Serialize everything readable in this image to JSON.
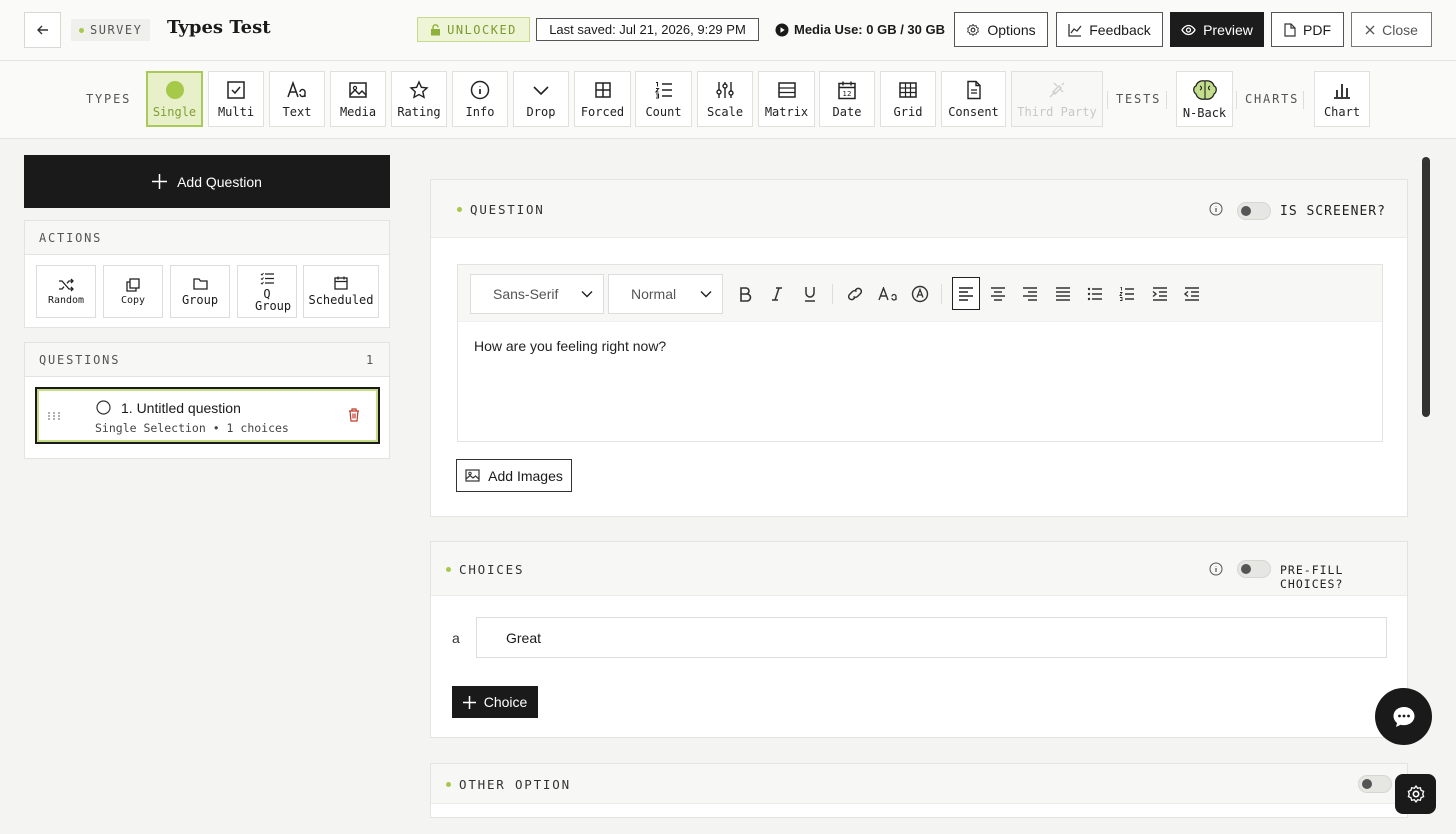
{
  "header": {
    "survey_tag": "SURVEY",
    "title": "Types Test",
    "lock_status": "UNLOCKED",
    "last_saved": "Last saved: Jul 21, 2026, 9:29 PM",
    "media_use": "Media Use: 0 GB / 30 GB",
    "buttons": {
      "options": "Options",
      "feedback": "Feedback",
      "preview": "Preview",
      "pdf": "PDF",
      "close": "Close"
    }
  },
  "toolbar": {
    "types_label": "TYPES",
    "tests_label": "TESTS",
    "charts_label": "CHARTS",
    "types": [
      {
        "label": "Single",
        "icon": "radio-filled-icon",
        "state": "active"
      },
      {
        "label": "Multi",
        "icon": "checkbox-icon"
      },
      {
        "label": "Text",
        "icon": "text-icon"
      },
      {
        "label": "Media",
        "icon": "image-icon"
      },
      {
        "label": "Rating",
        "icon": "star-icon"
      },
      {
        "label": "Info",
        "icon": "info-icon"
      },
      {
        "label": "Drop",
        "icon": "chevron-down-icon"
      },
      {
        "label": "Forced",
        "icon": "grid-icon"
      },
      {
        "label": "Count",
        "icon": "numbered-list-icon"
      },
      {
        "label": "Scale",
        "icon": "sliders-icon"
      },
      {
        "label": "Matrix",
        "icon": "matrix-icon"
      },
      {
        "label": "Date",
        "icon": "calendar-icon"
      },
      {
        "label": "Grid",
        "icon": "table-icon"
      },
      {
        "label": "Consent",
        "icon": "document-icon"
      },
      {
        "label": "Third Party",
        "icon": "plug-icon",
        "state": "disabled"
      }
    ],
    "tests": [
      {
        "label": "N-Back",
        "icon": "brain-icon"
      }
    ],
    "charts": [
      {
        "label": "Chart",
        "icon": "bar-chart-icon"
      }
    ]
  },
  "sidebar": {
    "add_question": "Add Question",
    "actions_title": "ACTIONS",
    "actions": [
      "Random",
      "Copy",
      "Group",
      "Q Group",
      "Scheduled"
    ],
    "questions_title": "QUESTIONS",
    "questions_count": "1",
    "questions": [
      {
        "title": "1. Untitled question",
        "subtitle": "Single Selection • 1 choices"
      }
    ]
  },
  "question_card": {
    "title": "QUESTION",
    "screener_label": "IS SCREENER?",
    "font_family": "Sans-Serif",
    "font_size": "Normal",
    "text": "How are you feeling right now?",
    "add_images": "Add Images"
  },
  "choices_card": {
    "title": "CHOICES",
    "prefill_label": "PRE-FILL CHOICES?",
    "choices": [
      {
        "letter": "a",
        "value": "Great"
      }
    ],
    "add_choice": "Choice"
  },
  "other_card": {
    "title": "OTHER OPTION"
  },
  "colors": {
    "accent": "#a6c94a",
    "active_bg": "#e7f0c8",
    "dark": "#1a1a1a",
    "delete": "#c0392b"
  }
}
